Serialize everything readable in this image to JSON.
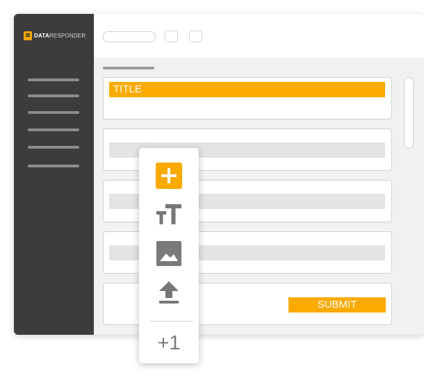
{
  "brand": {
    "name_bold": "DATA",
    "name_light": "RESPONDER",
    "accent": "#fbaa00",
    "sidebar_color": "#3c3c3c"
  },
  "form": {
    "title_label": "TITLE",
    "submit_label": "SUBMIT"
  },
  "toolbox": {
    "tools": [
      {
        "icon": "plus-icon",
        "label": "add-field"
      },
      {
        "icon": "text-size-icon",
        "label": "text"
      },
      {
        "icon": "image-icon",
        "label": "image"
      },
      {
        "icon": "upload-icon",
        "label": "upload"
      }
    ],
    "counter_label": "+1"
  }
}
